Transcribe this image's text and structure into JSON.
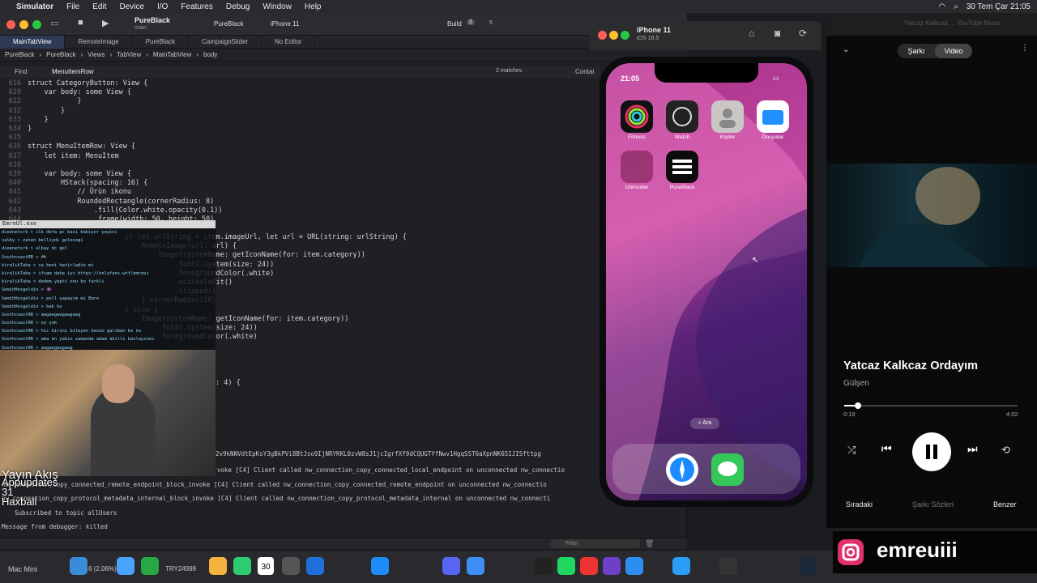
{
  "menubar": {
    "app": "Simulator",
    "items": [
      "File",
      "Edit",
      "Device",
      "I/O",
      "Features",
      "Debug",
      "Window",
      "Help"
    ],
    "clock": "30 Tem Çar  21:05"
  },
  "xcode": {
    "project": "PureBlack",
    "branch": "main",
    "scheme": "PureBlack",
    "device": "iPhone 11",
    "build": "Build",
    "warnings": "2",
    "errors": "5",
    "tabs": [
      "MainTabView",
      "RemoteImage",
      "PureBlack",
      "CampaignSlider",
      "No Editor"
    ],
    "breadcrumbs": [
      "PureBlack",
      "PureBlack",
      "Views",
      "TabView",
      "MainTabView",
      "body"
    ],
    "find": {
      "label": "Find",
      "query": "MenuItemRow",
      "matches": "2 matches",
      "contain": "Contai"
    },
    "code": [
      {
        "n": "616",
        "t": "struct CategoryButton: View {"
      },
      {
        "n": "620",
        "t": "    var body: some View {"
      },
      {
        "n": "622",
        "t": "            }"
      },
      {
        "n": "632",
        "t": "        }"
      },
      {
        "n": "633",
        "t": "    }"
      },
      {
        "n": "634",
        "t": "}"
      },
      {
        "n": "635",
        "t": ""
      },
      {
        "n": "636",
        "t": "struct MenuItemRow: View {"
      },
      {
        "n": "637",
        "t": "    let item: MenuItem"
      },
      {
        "n": "638",
        "t": ""
      },
      {
        "n": "639",
        "t": "    var body: some View {"
      },
      {
        "n": "640",
        "t": "        HStack(spacing: 16) {"
      },
      {
        "n": "641",
        "t": "            // Ürün ikonu"
      },
      {
        "n": "642",
        "t": "            RoundedRectangle(cornerRadius: 8)"
      },
      {
        "n": "643",
        "t": "                .fill(Color.white.opacity(0.1))"
      },
      {
        "n": "644",
        "t": "                .frame(width: 50, height: 50)"
      }
    ],
    "code2": [
      "if let urlString = item.imageUrl, let url = URL(string: urlString) {",
      "    RemoteImage(url: url) {",
      "        Image(systemName: getIconName(for: item.category))",
      "            .font(.system(size: 24))",
      "            .foregroundColor(.white)",
      "            .scaledToFit()",
      "            .clipped()",
      "    }.cornerRadius(10)",
      "} else {",
      "    Image(systemName: getIconName(for: item.category))",
      "        .font(.system(size: 24))",
      "        .foregroundColor(.white)"
    ],
    "code3": [
      ": 4) {"
    ],
    "hash": "2v9kNNVdtEpKsY3gBkPVi8BtJso9IjNRYKKL0zvW8sJ1jcIgrfXf9dCQUGTYfNwv1HgqSST6aXpnNK65IJISfttpg",
    "console": [
      "voke [C4] Client called nw_connection_copy_connected_local_endpoint on unconnected nw_connectio",
      "nw_connection_copy_connected_remote_endpoint_block_invoke [C4] Client called nw_connection_copy_connected_remote_endpoint on unconnected nw_connectio",
      "nw_connection_copy_protocol_metadata_internal_block_invoke [C4] Client called nw_connection_copy_protocol_metadata_internal on unconnected nw_connecti",
      "Subscribed to topic allUsers",
      "Message from debugger: killed"
    ],
    "filter": "Filter"
  },
  "chat": {
    "title": "EmreUl.exe",
    "rows": [
      "dieenetsrk > ilk defa pc basi bakiyor yayini",
      "salby > zaten belliydi gelecegi",
      "dieenetsrk > albay dc gel",
      "SouthcoastRR > 🎮",
      "kiralikTaha > sa beni hatirladin mi",
      "kiralikTaha > ifsam daha iyi https://onlyfans.wtf/emreui",
      "kiralikTaha > dedem yapti onu bu farkli",
      "SemihHosgeldin > 👾",
      "SemihHosgeldin > poll yapayim mi Emre",
      "SemihHosgeldin > bak bu",
      "SouthcoastRR > awgawgawgawgawg",
      "SouthcoastRR > oy yok",
      "SouthcoastRR > hic birini bileyen benim gariban ke nu",
      "SouthcoastRR > ama en yakin zamanda adam akilli baslayinos",
      "SouthcoastRR > awgawgawgawg"
    ]
  },
  "cam": {
    "l1": "Yayın Akış",
    "l2": "Appupdates",
    "l3": "31",
    "l4": "Haxball"
  },
  "simulator": {
    "device": "iPhone 11",
    "os": "iOS 18.5",
    "time": "21:05",
    "apps": [
      {
        "label": "Fitness"
      },
      {
        "label": "Watch"
      },
      {
        "label": "Kişiler"
      },
      {
        "label": "Dosyalar"
      },
      {
        "label": "İzlenceler"
      },
      {
        "label": "PureBlack"
      }
    ],
    "search": "Ara"
  },
  "music": {
    "tabSong": "Şarkı",
    "tabVideo": "Video",
    "header": "Yatcaz Kalkcaz ... YouTube Music",
    "title": "Yatcaz Kalkcaz Ordayım",
    "artist": "Gülşen",
    "current": "0:19",
    "total": "4:02",
    "progress": 0.08,
    "bottom": [
      "Sıradaki",
      "Şarkı Sözleri",
      "Benzer"
    ]
  },
  "dock": {
    "memory": "51.6 (2.06%)",
    "price": "TRY24999",
    "date": "30",
    "host": "Mac Mini"
  },
  "social": {
    "handle": "emreuiii"
  }
}
